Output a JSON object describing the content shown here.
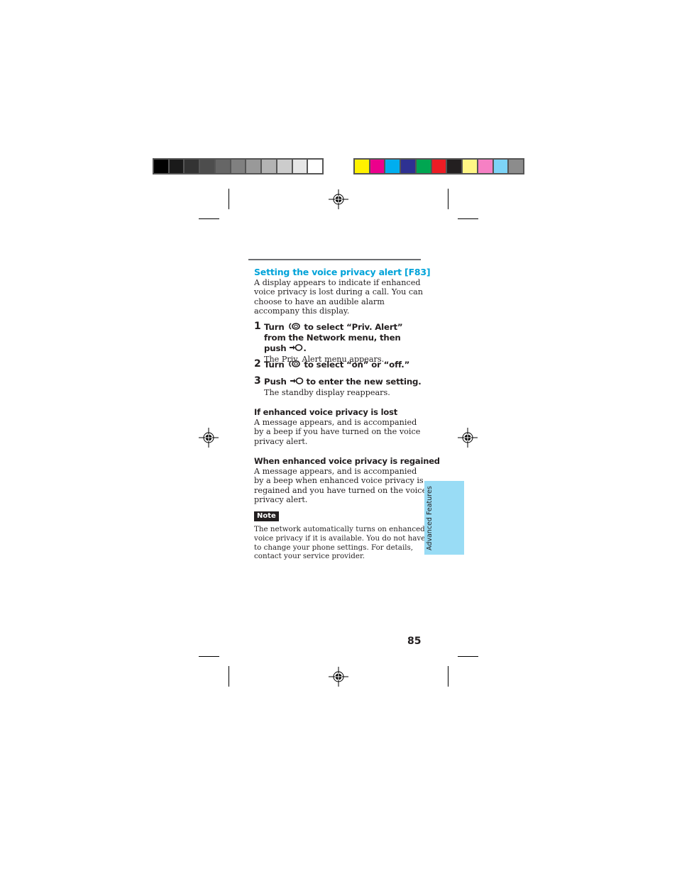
{
  "print_marks": {
    "grayscale_bar": [
      "#000000",
      "#1a1a1a",
      "#333333",
      "#4d4d4d",
      "#666666",
      "#808080",
      "#999999",
      "#b3b3b3",
      "#cccccc",
      "#e6e6e6",
      "#ffffff"
    ],
    "color_bar": [
      "#fff200",
      "#ec008c",
      "#00aeef",
      "#2e3192",
      "#00a651",
      "#ed1c24",
      "#231f20",
      "#fff685",
      "#f680c4",
      "#7dd4f7",
      "#8c8c8c"
    ]
  },
  "section": {
    "title": "Setting the voice privacy alert [F83]",
    "title_color": "#00a3d9",
    "intro": "A display appears to indicate if enhanced voice privacy is lost during a call. You can choose to have an audible alarm accompany this display."
  },
  "steps": [
    {
      "number": "1",
      "parts": [
        "Turn",
        "jog-dial-icon",
        "to select “Priv. Alert” from the Network menu, then push",
        "push-jog-icon",
        "."
      ],
      "result": "The Priv. Alert menu appears."
    },
    {
      "number": "2",
      "parts": [
        "Turn",
        "jog-dial-icon",
        "to select “on” or “off.”"
      ],
      "result": ""
    },
    {
      "number": "3",
      "parts": [
        "Push",
        "push-jog-icon",
        "to enter the new setting."
      ],
      "result": "The standby display reappears."
    }
  ],
  "subsections": [
    {
      "heading": "If enhanced voice privacy is lost",
      "body": "A message appears, and is accompanied by a beep if you have turned on the voice privacy alert."
    },
    {
      "heading": "When enhanced voice privacy is regained",
      "body": "A message appears, and is accompanied by a beep when enhanced voice privacy is regained and you have turned on the voice privacy alert."
    }
  ],
  "note": {
    "label": "Note",
    "text": "The network automatically turns on enhanced voice privacy if it is available. You do not have to change your phone settings. For details, contact your service provider."
  },
  "side_tab": {
    "label": "Advanced Features",
    "color": "#99dcf5"
  },
  "page_number": "85"
}
